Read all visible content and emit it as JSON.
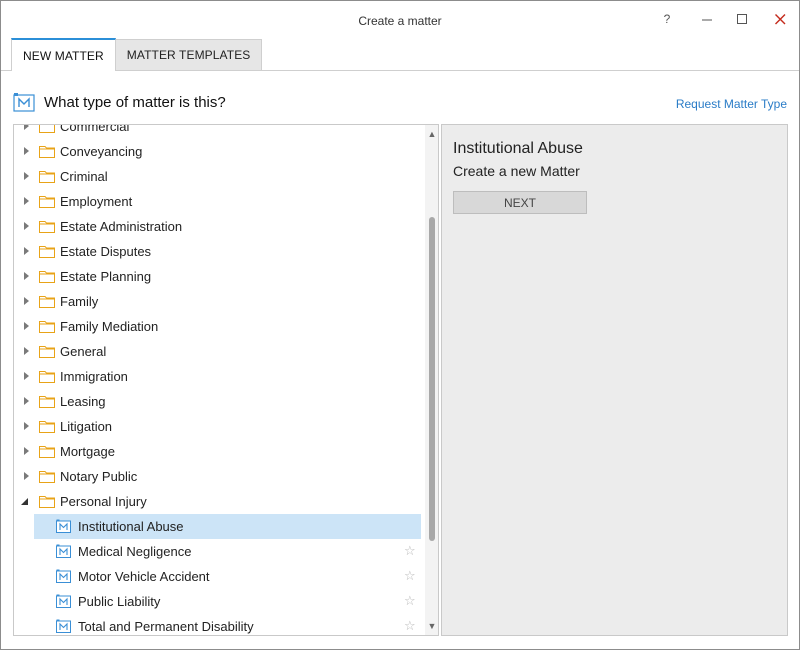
{
  "window": {
    "title": "Create a matter",
    "help_glyph": "?",
    "minimize_glyph": "–",
    "maximize_glyph": "☐",
    "close_glyph": "✕"
  },
  "tabs": [
    {
      "label": "NEW MATTER",
      "active": true
    },
    {
      "label": "MATTER TEMPLATES",
      "active": false
    }
  ],
  "heading": {
    "text": "What type of matter is this?",
    "icon": "matter-type-icon",
    "request_link": "Request Matter Type"
  },
  "tree": {
    "categories": [
      {
        "label": "Commercial",
        "expanded": false
      },
      {
        "label": "Conveyancing",
        "expanded": false
      },
      {
        "label": "Criminal",
        "expanded": false
      },
      {
        "label": "Employment",
        "expanded": false
      },
      {
        "label": "Estate Administration",
        "expanded": false
      },
      {
        "label": "Estate Disputes",
        "expanded": false
      },
      {
        "label": "Estate Planning",
        "expanded": false
      },
      {
        "label": "Family",
        "expanded": false
      },
      {
        "label": "Family Mediation",
        "expanded": false
      },
      {
        "label": "General",
        "expanded": false
      },
      {
        "label": "Immigration",
        "expanded": false
      },
      {
        "label": "Leasing",
        "expanded": false
      },
      {
        "label": "Litigation",
        "expanded": false
      },
      {
        "label": "Mortgage",
        "expanded": false
      },
      {
        "label": "Notary Public",
        "expanded": false
      },
      {
        "label": "Personal Injury",
        "expanded": true
      }
    ],
    "children": [
      {
        "label": "Institutional Abuse",
        "selected": true
      },
      {
        "label": "Medical Negligence",
        "selected": false
      },
      {
        "label": "Motor Vehicle Accident",
        "selected": false
      },
      {
        "label": "Public Liability",
        "selected": false
      },
      {
        "label": "Total and Permanent Disability",
        "selected": false
      }
    ],
    "star_glyph": "☆"
  },
  "detail": {
    "title": "Institutional Abuse",
    "subtitle": "Create a new Matter",
    "next_label": "NEXT"
  },
  "colors": {
    "accent": "#2b8fd8",
    "link": "#2a7cc7",
    "selection": "#cce4f7",
    "folder": "#e8a317",
    "close": "#c42b1c"
  }
}
